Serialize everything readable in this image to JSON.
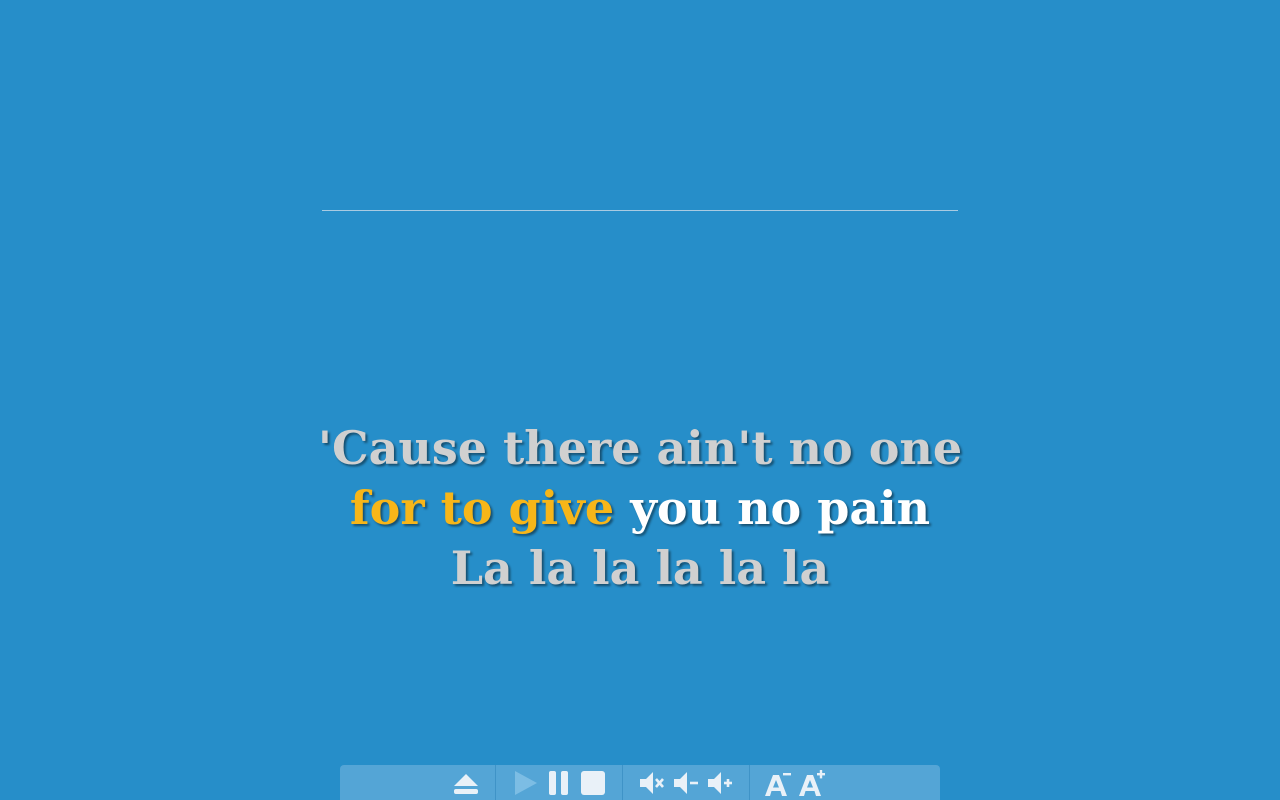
{
  "lyrics": {
    "line1": "'Cause there ain't no one",
    "line2_sung": "for to give",
    "line2_unsung": "you no pain",
    "line3": "La la la la la la"
  },
  "controls": {
    "eject": "eject-icon",
    "play": "play-icon",
    "pause": "pause-icon",
    "stop": "stop-icon",
    "mute": "volume-mute-icon",
    "volume_down": "volume-down-icon",
    "volume_up": "volume-up-icon",
    "font_smaller": "font-decrease-icon",
    "font_larger": "font-increase-icon"
  },
  "colors": {
    "background": "#268ec9",
    "sung_text": "#f7b619",
    "current_text": "#ffffff",
    "other_text": "#d0d0d0",
    "control_bar": "#54a5d6"
  }
}
